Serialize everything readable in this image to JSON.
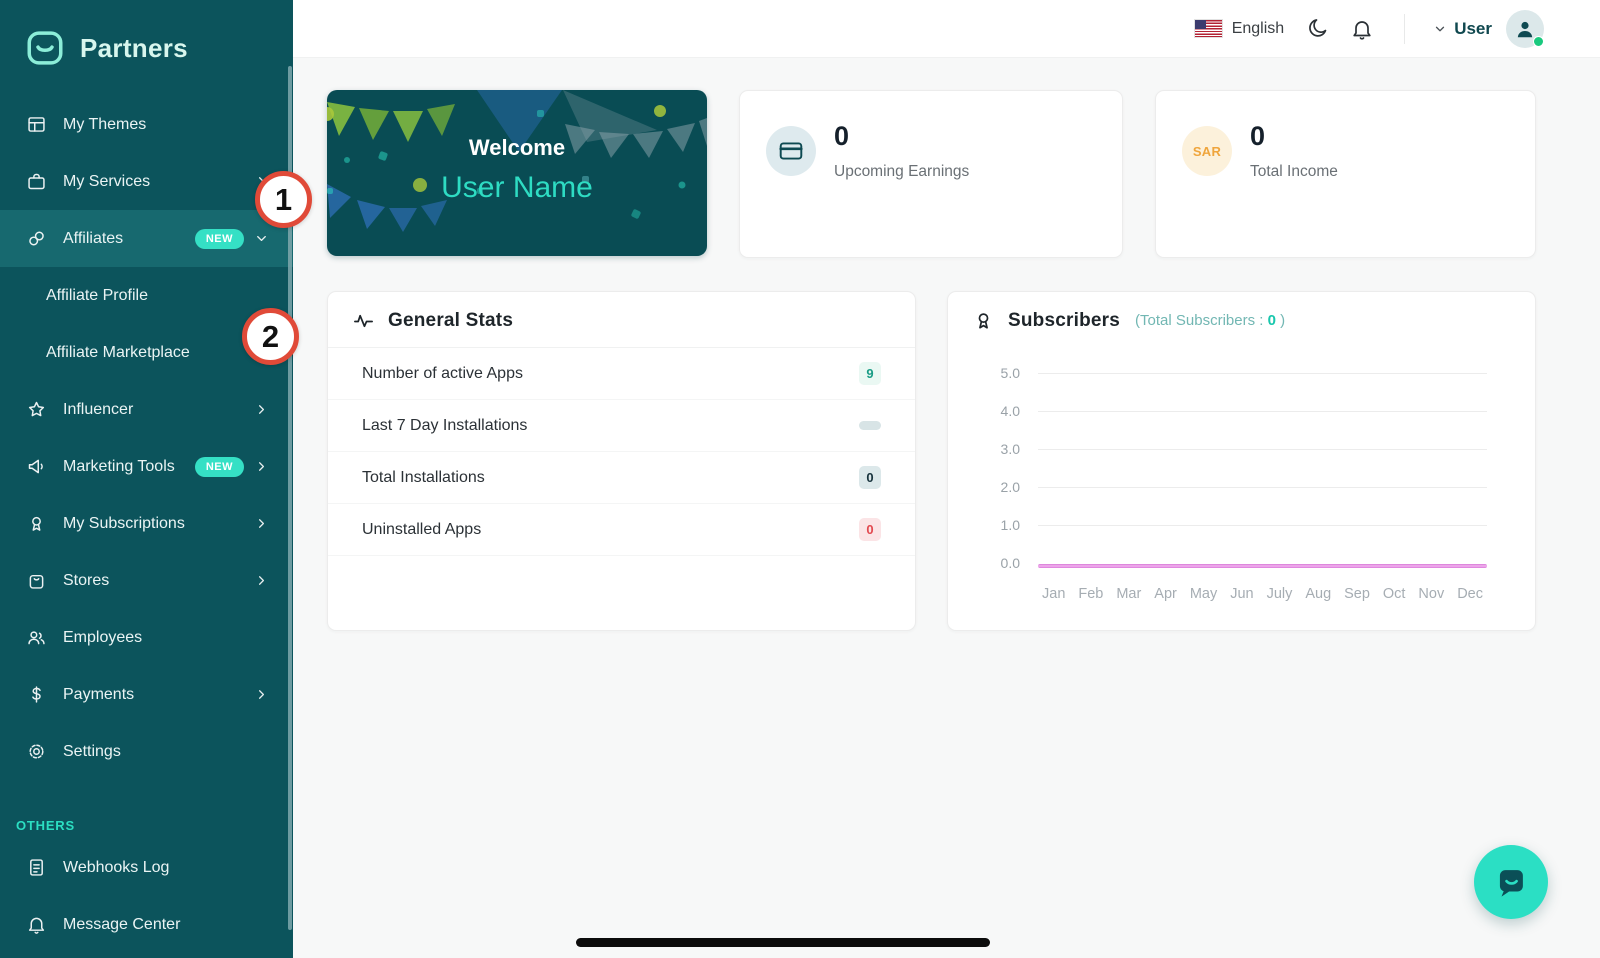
{
  "brand": {
    "name": "Partners"
  },
  "header": {
    "language": "English",
    "user_label": "User"
  },
  "sidebar": {
    "items": [
      {
        "label": "My Themes"
      },
      {
        "label": "My Services"
      },
      {
        "label": "Affiliates",
        "badge": "NEW"
      },
      {
        "label": "Affiliate Profile"
      },
      {
        "label": "Affiliate Marketplace"
      },
      {
        "label": "Influencer"
      },
      {
        "label": "Marketing Tools",
        "badge": "NEW"
      },
      {
        "label": "My Subscriptions"
      },
      {
        "label": "Stores"
      },
      {
        "label": "Employees"
      },
      {
        "label": "Payments"
      },
      {
        "label": "Settings"
      }
    ],
    "others_label": "OTHERS",
    "others": [
      {
        "label": "Webhooks Log"
      },
      {
        "label": "Message Center"
      }
    ]
  },
  "welcome": {
    "title": "Welcome",
    "name": "User Name"
  },
  "stats": {
    "earnings": {
      "value": "0",
      "label": "Upcoming Earnings"
    },
    "income": {
      "value": "0",
      "label": "Total Income",
      "currency": "SAR"
    }
  },
  "general_stats": {
    "title": "General Stats",
    "rows": [
      {
        "label": "Number of active Apps",
        "value": "9"
      },
      {
        "label": "Last 7 Day Installations",
        "value": ""
      },
      {
        "label": "Total Installations",
        "value": "0"
      },
      {
        "label": "Uninstalled Apps",
        "value": "0"
      }
    ]
  },
  "subscribers": {
    "title": "Subscribers",
    "total_prefix": "(Total Subscribers :",
    "total_value": "0",
    "total_suffix": ")"
  },
  "chart_data": {
    "type": "line",
    "title": "Subscribers",
    "categories": [
      "Jan",
      "Feb",
      "Mar",
      "Apr",
      "May",
      "Jun",
      "July",
      "Aug",
      "Sep",
      "Oct",
      "Nov",
      "Dec"
    ],
    "values": [
      0,
      0,
      0,
      0,
      0,
      0,
      0,
      0,
      0,
      0,
      0,
      0
    ],
    "yticks": [
      "5.0",
      "4.0",
      "3.0",
      "2.0",
      "1.0",
      "0.0"
    ],
    "ylim": [
      0,
      5
    ],
    "xlabel": "",
    "ylabel": "",
    "grid": true,
    "legend": false,
    "line_color": "#DA7AD9"
  },
  "annotations": {
    "step1": "1",
    "step2": "2"
  },
  "colors": {
    "sidebar": "#0C545C",
    "accent": "#2EDCC3",
    "badge_new": "#35E0C5",
    "annotation_ring": "#E04A38",
    "chart_line": "#DA7AD9",
    "sar_text": "#EFA53C",
    "online_dot": "#19C97E"
  }
}
